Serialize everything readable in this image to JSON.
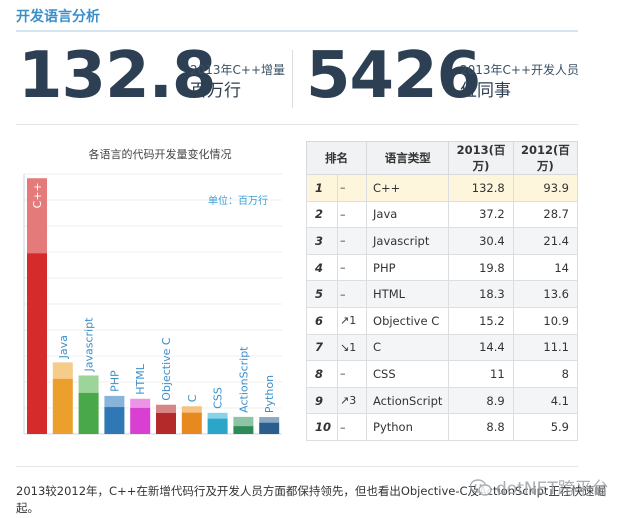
{
  "header": {
    "title": "开发语言分析"
  },
  "stats": [
    {
      "value": "132.8",
      "label": "2013年C++增量",
      "unit": "百万行"
    },
    {
      "value": "5426",
      "label": "2013年C++开发人员",
      "unit": "位同事"
    }
  ],
  "chart_data": {
    "type": "bar",
    "title": "各语言的代码开发量变化情况",
    "unit_label": "单位：百万行",
    "xlabel": "",
    "ylabel": "",
    "grid": true,
    "categories": [
      "C++",
      "Java",
      "Javascript",
      "PHP",
      "HTML",
      "Objective C",
      "C",
      "CSS",
      "ActionScript",
      "Python"
    ],
    "series": [
      {
        "name": "2012",
        "values": [
          93.9,
          28.7,
          21.4,
          14,
          13.6,
          10.9,
          11.1,
          8,
          4.1,
          5.9
        ]
      },
      {
        "name": "2013",
        "values": [
          132.8,
          37.2,
          30.4,
          19.8,
          18.3,
          15.2,
          14.4,
          11,
          8.9,
          8.8
        ]
      }
    ],
    "bar_colors": [
      "#d52b2b",
      "#eba02e",
      "#49a84a",
      "#2f78b5",
      "#d93fd0",
      "#b42a2a",
      "#e8891f",
      "#2aa6c9",
      "#2f8a5a",
      "#2b5d8f"
    ],
    "bar_colors_light": [
      "#e47a7a",
      "#f5cc8a",
      "#9cd49a",
      "#88b4dc",
      "#ec94e6",
      "#d88585",
      "#f5c283",
      "#8ad3e6",
      "#8dc5a4",
      "#8aa8c6"
    ],
    "ylim": [
      0,
      135
    ]
  },
  "table": {
    "headers": [
      "排名",
      "语言类型",
      "2013(百万)",
      "2012(百万)"
    ],
    "rows": [
      {
        "rank": "1",
        "change": "–",
        "lang": "C++",
        "y2013": "132.8",
        "y2012": "93.9"
      },
      {
        "rank": "2",
        "change": "–",
        "lang": "Java",
        "y2013": "37.2",
        "y2012": "28.7"
      },
      {
        "rank": "3",
        "change": "–",
        "lang": "Javascript",
        "y2013": "30.4",
        "y2012": "21.4"
      },
      {
        "rank": "4",
        "change": "–",
        "lang": "PHP",
        "y2013": "19.8",
        "y2012": "14"
      },
      {
        "rank": "5",
        "change": "–",
        "lang": "HTML",
        "y2013": "18.3",
        "y2012": "13.6"
      },
      {
        "rank": "6",
        "change": "↗1",
        "lang": "Objective C",
        "y2013": "15.2",
        "y2012": "10.9"
      },
      {
        "rank": "7",
        "change": "↘1",
        "lang": "C",
        "y2013": "14.4",
        "y2012": "11.1"
      },
      {
        "rank": "8",
        "change": "–",
        "lang": "CSS",
        "y2013": "11",
        "y2012": "8"
      },
      {
        "rank": "9",
        "change": "↗3",
        "lang": "ActionScript",
        "y2013": "8.9",
        "y2012": "4.1"
      },
      {
        "rank": "10",
        "change": "–",
        "lang": "Python",
        "y2013": "8.8",
        "y2012": "5.9"
      }
    ],
    "highlight_color": "#fdf6dc",
    "up_color": "#f0a030",
    "down_color": "#4aa35a"
  },
  "footer": {
    "text": "2013较2012年，C++在新增代码行及开发人员方面都保持领先，但也看出Objective-C及ActionScript正在快速崛起。",
    "watermark": "dotNET跨平台"
  }
}
